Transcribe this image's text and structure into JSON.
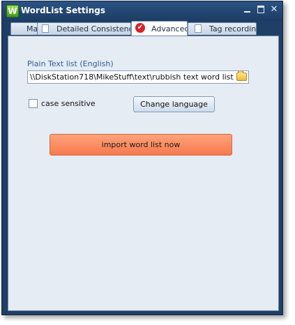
{
  "window": {
    "title": "WordList Settings",
    "app_icon_letter": "W"
  },
  "tabs": [
    {
      "label": "Mair",
      "icon": "page-icon",
      "active": false
    },
    {
      "label": "Detailed Consistency",
      "icon": "page-icon",
      "active": false
    },
    {
      "label": "Advanced",
      "icon": "check-circle-icon",
      "active": true
    },
    {
      "label": "Tag recording",
      "icon": "page-icon",
      "active": false
    }
  ],
  "advanced": {
    "list_label": "Plain Text list (English)",
    "path_value": "\\\\DiskStation718\\MikeStuff\\text\\rubbish text word list dot sepa",
    "case_sensitive_label": "case sensitive",
    "case_sensitive_checked": false,
    "change_language_label": "Change language",
    "import_label": "import word list now"
  },
  "colors": {
    "titlebar": "#1f3f66",
    "panel": "#e5ecf4",
    "accent_label": "#2e5f95",
    "import_button": "#f7794e"
  }
}
